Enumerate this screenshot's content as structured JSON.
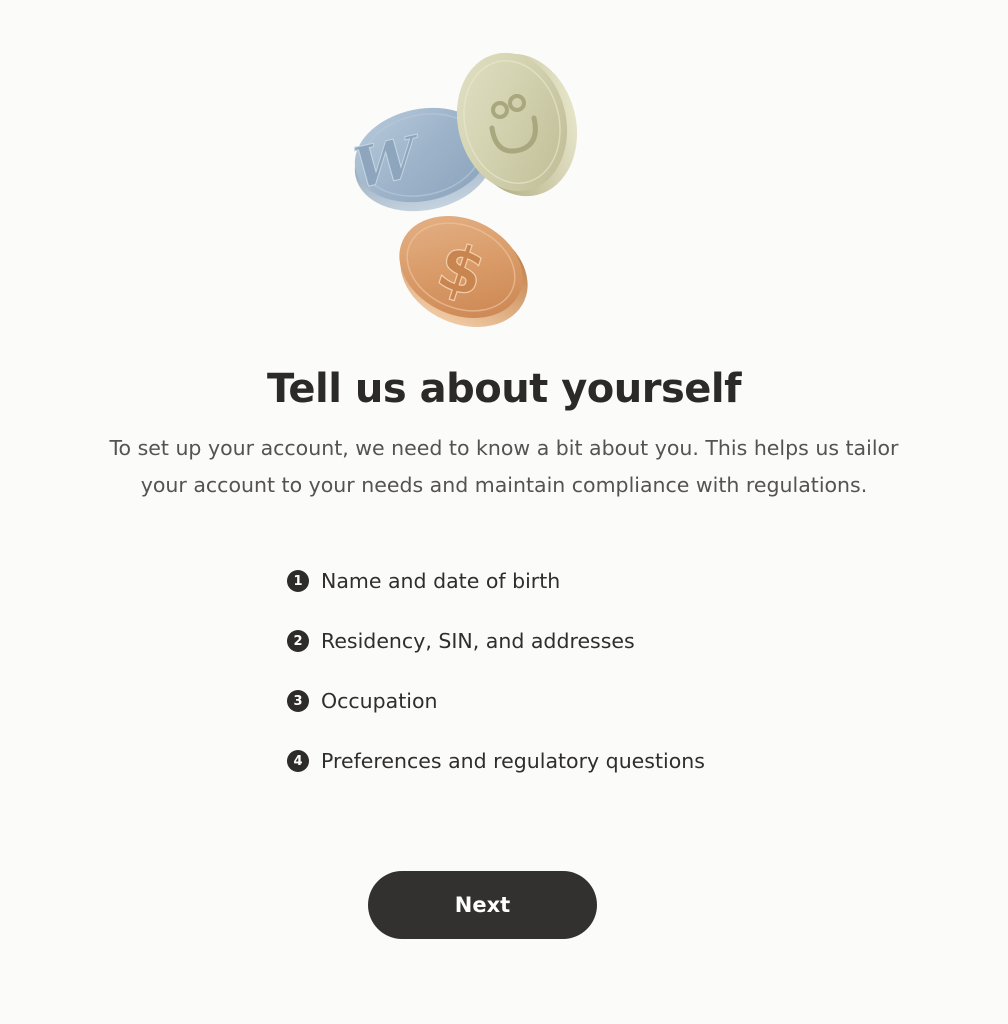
{
  "hero": {
    "coins": [
      {
        "icon": "w-logo-icon",
        "color": "#9fb6cc"
      },
      {
        "icon": "smiley-icon",
        "color": "#d3d2b0"
      },
      {
        "icon": "dollar-icon",
        "color": "#d9a070"
      }
    ]
  },
  "page": {
    "title": "Tell us about yourself",
    "subtitle": "To set up your account, we need to know a bit about you. This helps us tailor your account to your needs and maintain compliance with regulations."
  },
  "steps": [
    {
      "number": "1",
      "label": "Name and date of birth"
    },
    {
      "number": "2",
      "label": "Residency, SIN, and addresses"
    },
    {
      "number": "3",
      "label": "Occupation"
    },
    {
      "number": "4",
      "label": "Preferences and regulatory questions"
    }
  ],
  "actions": {
    "next_label": "Next"
  },
  "colors": {
    "background": "#fbfbfa",
    "button": "#32312f",
    "text": "#2f2e2c"
  }
}
